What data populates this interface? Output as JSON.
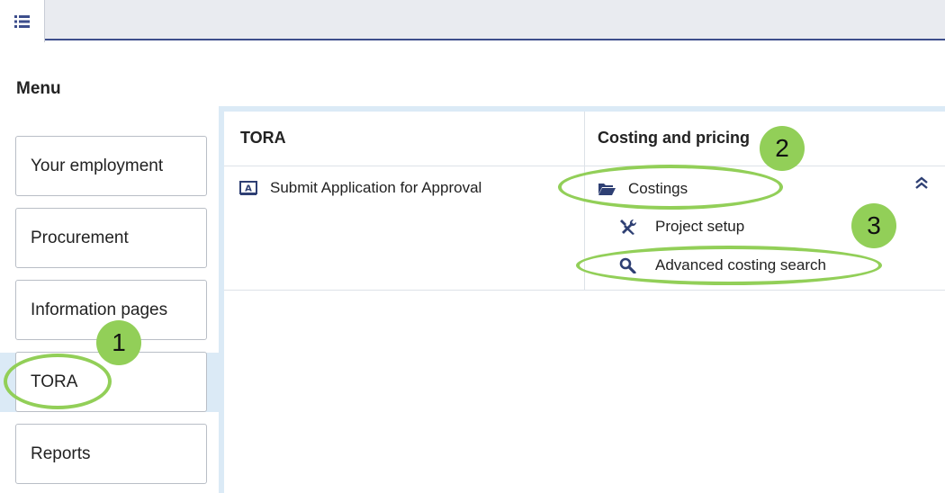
{
  "menu": {
    "title": "Menu",
    "items": [
      {
        "label": "Your employment"
      },
      {
        "label": "Procurement"
      },
      {
        "label": "Information pages"
      },
      {
        "label": "TORA"
      },
      {
        "label": "Reports"
      }
    ],
    "active": "TORA"
  },
  "panel": {
    "columns": [
      {
        "header": "TORA",
        "links": [
          {
            "label": "Submit Application for Approval",
            "icon": "application-form-icon"
          }
        ]
      },
      {
        "header": "Costing and pricing",
        "links": [
          {
            "label": "Costings",
            "icon": "folder-open-icon"
          },
          {
            "label": "Project setup",
            "icon": "tools-icon"
          },
          {
            "label": "Advanced costing search",
            "icon": "search-icon"
          }
        ]
      }
    ]
  },
  "annotations": [
    "1",
    "2",
    "3"
  ],
  "colors": {
    "accent": "#3d4e8c",
    "active_bg": "#dbeaf6",
    "annotation": "#92cf58"
  }
}
